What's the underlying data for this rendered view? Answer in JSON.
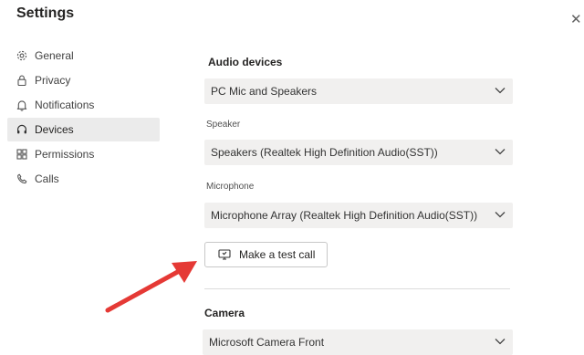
{
  "window": {
    "title": "Settings",
    "close_glyph": "✕"
  },
  "nav": {
    "items": [
      {
        "label": "General",
        "icon": "gear-icon"
      },
      {
        "label": "Privacy",
        "icon": "lock-icon"
      },
      {
        "label": "Notifications",
        "icon": "bell-icon"
      },
      {
        "label": "Devices",
        "icon": "headset-icon",
        "active": true
      },
      {
        "label": "Permissions",
        "icon": "grid-icon"
      },
      {
        "label": "Calls",
        "icon": "phone-icon"
      }
    ]
  },
  "devices": {
    "audio_heading": "Audio devices",
    "audio_value": "PC Mic and Speakers",
    "speaker_label": "Speaker",
    "speaker_value": "Speakers (Realtek High Definition Audio(SST))",
    "mic_label": "Microphone",
    "mic_value": "Microphone Array (Realtek High Definition Audio(SST))",
    "test_call_label": "Make a test call",
    "camera_heading": "Camera",
    "camera_value": "Microsoft Camera Front"
  },
  "colors": {
    "arrow": "#e53935",
    "active_bg": "#ebebeb",
    "dropdown_bg": "#f1f0ef"
  }
}
